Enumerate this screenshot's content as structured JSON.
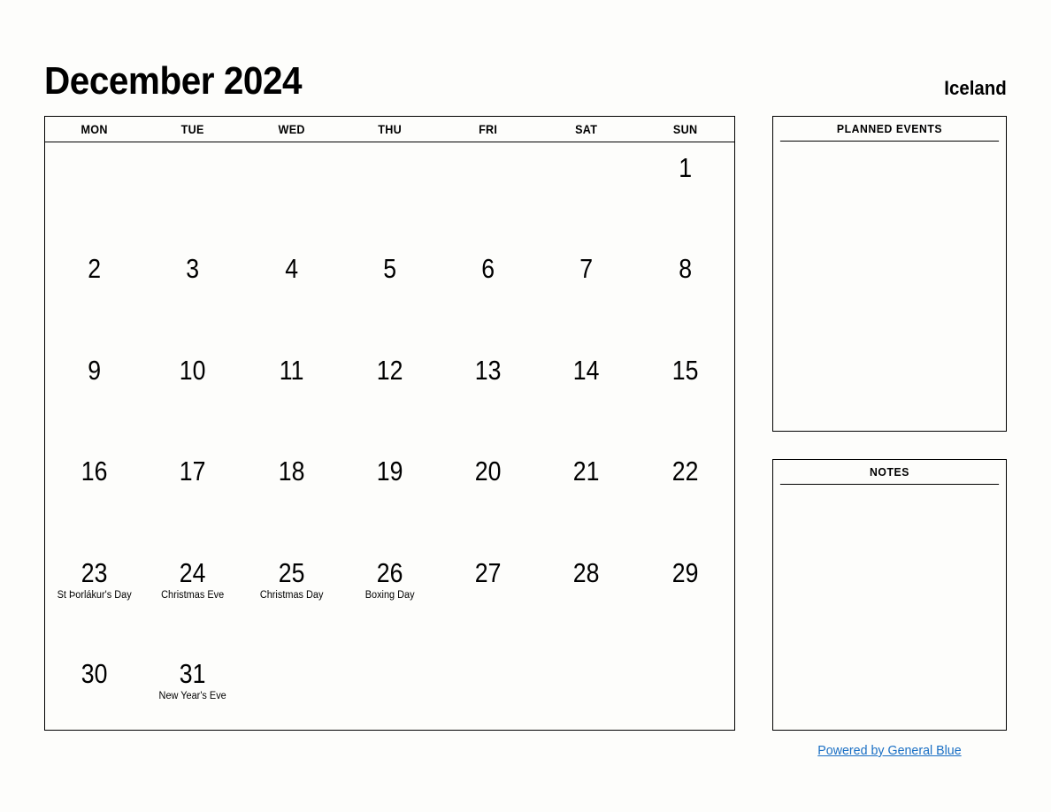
{
  "header": {
    "title": "December 2024",
    "country": "Iceland"
  },
  "calendar": {
    "weekdays": [
      "MON",
      "TUE",
      "WED",
      "THU",
      "FRI",
      "SAT",
      "SUN"
    ],
    "weeks": [
      [
        {
          "day": "",
          "holiday": ""
        },
        {
          "day": "",
          "holiday": ""
        },
        {
          "day": "",
          "holiday": ""
        },
        {
          "day": "",
          "holiday": ""
        },
        {
          "day": "",
          "holiday": ""
        },
        {
          "day": "",
          "holiday": ""
        },
        {
          "day": "1",
          "holiday": ""
        }
      ],
      [
        {
          "day": "2",
          "holiday": ""
        },
        {
          "day": "3",
          "holiday": ""
        },
        {
          "day": "4",
          "holiday": ""
        },
        {
          "day": "5",
          "holiday": ""
        },
        {
          "day": "6",
          "holiday": ""
        },
        {
          "day": "7",
          "holiday": ""
        },
        {
          "day": "8",
          "holiday": ""
        }
      ],
      [
        {
          "day": "9",
          "holiday": ""
        },
        {
          "day": "10",
          "holiday": ""
        },
        {
          "day": "11",
          "holiday": ""
        },
        {
          "day": "12",
          "holiday": ""
        },
        {
          "day": "13",
          "holiday": ""
        },
        {
          "day": "14",
          "holiday": ""
        },
        {
          "day": "15",
          "holiday": ""
        }
      ],
      [
        {
          "day": "16",
          "holiday": ""
        },
        {
          "day": "17",
          "holiday": ""
        },
        {
          "day": "18",
          "holiday": ""
        },
        {
          "day": "19",
          "holiday": ""
        },
        {
          "day": "20",
          "holiday": ""
        },
        {
          "day": "21",
          "holiday": ""
        },
        {
          "day": "22",
          "holiday": ""
        }
      ],
      [
        {
          "day": "23",
          "holiday": "St Þorlákur's Day"
        },
        {
          "day": "24",
          "holiday": "Christmas Eve"
        },
        {
          "day": "25",
          "holiday": "Christmas Day"
        },
        {
          "day": "26",
          "holiday": "Boxing Day"
        },
        {
          "day": "27",
          "holiday": ""
        },
        {
          "day": "28",
          "holiday": ""
        },
        {
          "day": "29",
          "holiday": ""
        }
      ],
      [
        {
          "day": "30",
          "holiday": ""
        },
        {
          "day": "31",
          "holiday": "New Year's Eve"
        },
        {
          "day": "",
          "holiday": ""
        },
        {
          "day": "",
          "holiday": ""
        },
        {
          "day": "",
          "holiday": ""
        },
        {
          "day": "",
          "holiday": ""
        },
        {
          "day": "",
          "holiday": ""
        }
      ]
    ]
  },
  "panels": {
    "planned_events": {
      "title": "PLANNED EVENTS",
      "content": ""
    },
    "notes": {
      "title": "NOTES",
      "content": ""
    }
  },
  "footer": {
    "link_text": "Powered by General Blue",
    "link_color": "#1a6fc4"
  }
}
